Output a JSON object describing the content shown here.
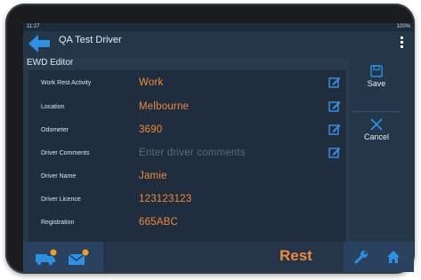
{
  "statusbar": {
    "time": "11:27",
    "indicators": "100%"
  },
  "appbar": {
    "title": "QA Test Driver",
    "back_icon": "back-arrow-icon",
    "menu_icon": "more-vert-icon"
  },
  "editor": {
    "title": "EWD Editor"
  },
  "fields": [
    {
      "label": "Work Rest Activity",
      "value": "Work",
      "placeholder": "",
      "editable": true
    },
    {
      "label": "Location",
      "value": "Melbourne",
      "placeholder": "",
      "editable": true
    },
    {
      "label": "Odometer",
      "value": "3690",
      "placeholder": "",
      "editable": true
    },
    {
      "label": "Driver Comments",
      "value": "",
      "placeholder": "Enter driver comments",
      "editable": true
    },
    {
      "label": "Driver Name",
      "value": "Jamie",
      "placeholder": "",
      "editable": false
    },
    {
      "label": "Driver Licence",
      "value": "123123123",
      "placeholder": "",
      "editable": false
    },
    {
      "label": "Registration",
      "value": "665ABC",
      "placeholder": "",
      "editable": false
    }
  ],
  "sidebar": {
    "save_label": "Save",
    "cancel_label": "Cancel"
  },
  "bottombar": {
    "status_label": "Rest",
    "icons": [
      "truck-icon",
      "mail-icon",
      "wrench-icon",
      "home-icon"
    ]
  },
  "colors": {
    "accent": "#f08a3c",
    "primary": "#2f8fe0",
    "panel": "#1f2d3e",
    "screen": "#2a3a4d"
  }
}
